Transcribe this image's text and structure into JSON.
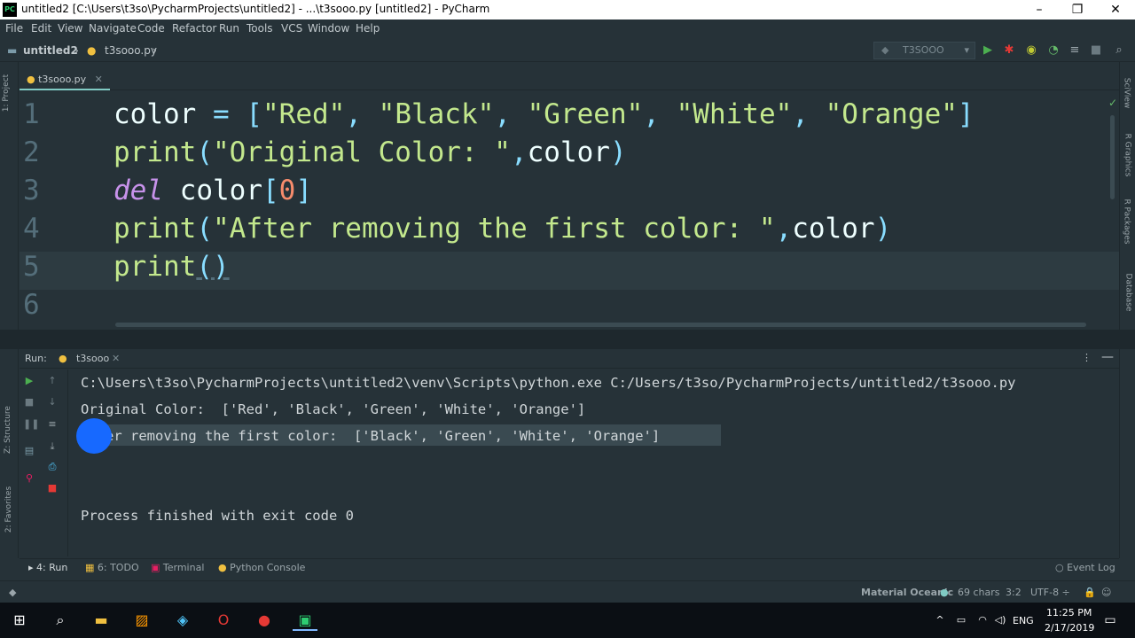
{
  "window": {
    "title": "untitled2 [C:\\Users\\t3so\\PycharmProjects\\untitled2] - ...\\t3sooo.py [untitled2] - PyCharm",
    "app_icon": "pc-logo-icon",
    "minimize": "–",
    "maximize": "❐",
    "close": "✕"
  },
  "menu": [
    "File",
    "Edit",
    "View",
    "Navigate",
    "Code",
    "Refactor",
    "Run",
    "Tools",
    "VCS",
    "Window",
    "Help"
  ],
  "navbar": {
    "project": "untitled2",
    "file": "t3sooo.py",
    "run_config": "T3SOOO"
  },
  "left_tool": {
    "project_label": "1: Project",
    "structure_label": "Z: Structure",
    "favorites_label": "2: Favorites"
  },
  "right_tool": {
    "sciview": "SciView",
    "rgraphics": "R Graphics",
    "rpackages": "R Packages",
    "database": "Database"
  },
  "editor": {
    "tab_label": "t3sooo.py",
    "tab_close": "✕",
    "line_numbers": [
      "1",
      "2",
      "3",
      "4",
      "5",
      "6"
    ]
  },
  "code": {
    "l1": [
      "color",
      " = ",
      "[",
      "\"Red\"",
      ", ",
      "\"Black\"",
      ", ",
      "\"Green\"",
      ", ",
      "\"White\"",
      ", ",
      "\"Orange\"",
      "]"
    ],
    "l2": [
      "print",
      "(",
      "\"Original Color: \"",
      ",",
      "color",
      ")"
    ],
    "l3": [
      "del",
      " color",
      "[",
      "0",
      "]"
    ],
    "l4": [
      "print",
      "(",
      "\"After removing the first color: \"",
      ",",
      "color",
      ")"
    ],
    "l5": [
      "print",
      "()"
    ]
  },
  "run_panel": {
    "label": "Run:",
    "tab": "t3sooo",
    "tab_close": "✕",
    "console": [
      "C:\\Users\\t3so\\PycharmProjects\\untitled2\\venv\\Scripts\\python.exe C:/Users/t3so/PycharmProjects/untitled2/t3sooo.py",
      "Original Color:  ['Red', 'Black', 'Green', 'White', 'Orange']",
      "After removing the first color:  ['Black', 'Green', 'White', 'Orange']",
      "",
      "",
      "Process finished with exit code 0"
    ]
  },
  "bottom_tabs": {
    "run": "4: Run",
    "todo": "6: TODO",
    "terminal": "Terminal",
    "python_console": "Python Console",
    "event_log": "Event Log"
  },
  "status": {
    "theme": "Material Oceanic",
    "chars": "69 chars",
    "position": "3:2",
    "encoding": "UTF-8 ÷"
  },
  "taskbar": {
    "lang": "ENG",
    "time": "11:25 PM",
    "date": "2/17/2019"
  },
  "colors": {
    "background": "#263238",
    "accent": "#80cbc4",
    "string": "#c3e88d",
    "keyword": "#c792ea",
    "number": "#f78c6c"
  }
}
